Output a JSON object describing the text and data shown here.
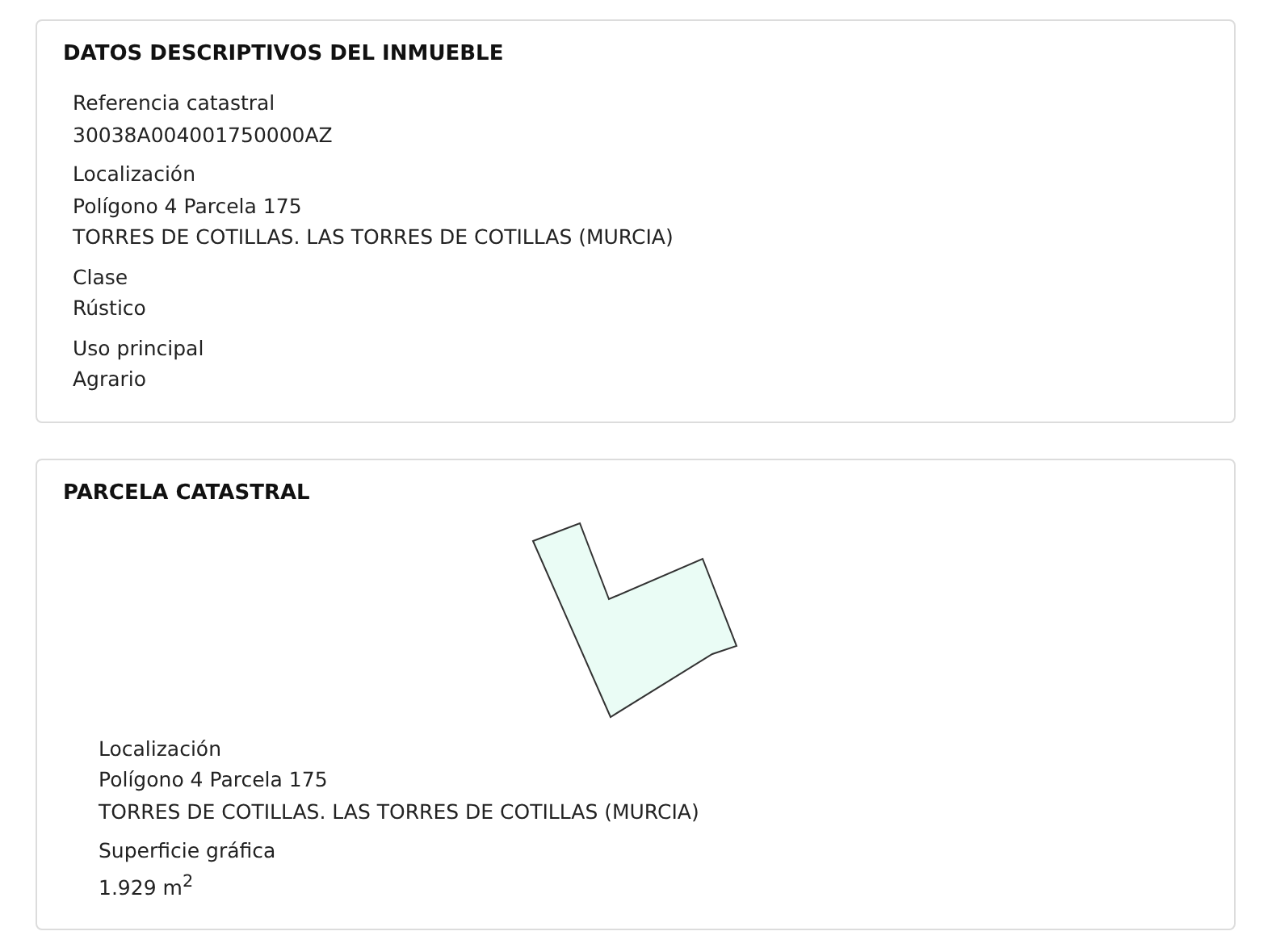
{
  "sections": [
    {
      "title": "DATOS DESCRIPTIVOS DEL INMUEBLE",
      "fields": [
        {
          "label": "Referencia catastral",
          "lines": [
            "30038A004001750000AZ"
          ]
        },
        {
          "label": "Localización",
          "lines": [
            "Polígono 4 Parcela 175",
            "TORRES DE COTILLAS. LAS TORRES DE COTILLAS (MURCIA)"
          ]
        },
        {
          "label": "Clase",
          "lines": [
            "Rústico"
          ]
        },
        {
          "label": "Uso principal",
          "lines": [
            "Agrario"
          ]
        }
      ]
    },
    {
      "title": "PARCELA CATASTRAL",
      "kind": "parcel",
      "fields": [
        {
          "label": "Localización",
          "lines": [
            "Polígono 4 Parcela 175",
            "TORRES DE COTILLAS. LAS TORRES DE COTILLAS (MURCIA)"
          ]
        },
        {
          "label": "Superficie gráfica",
          "lines": [
            "1.929 m$^{2}$"
          ]
        }
      ]
    }
  ]
}
